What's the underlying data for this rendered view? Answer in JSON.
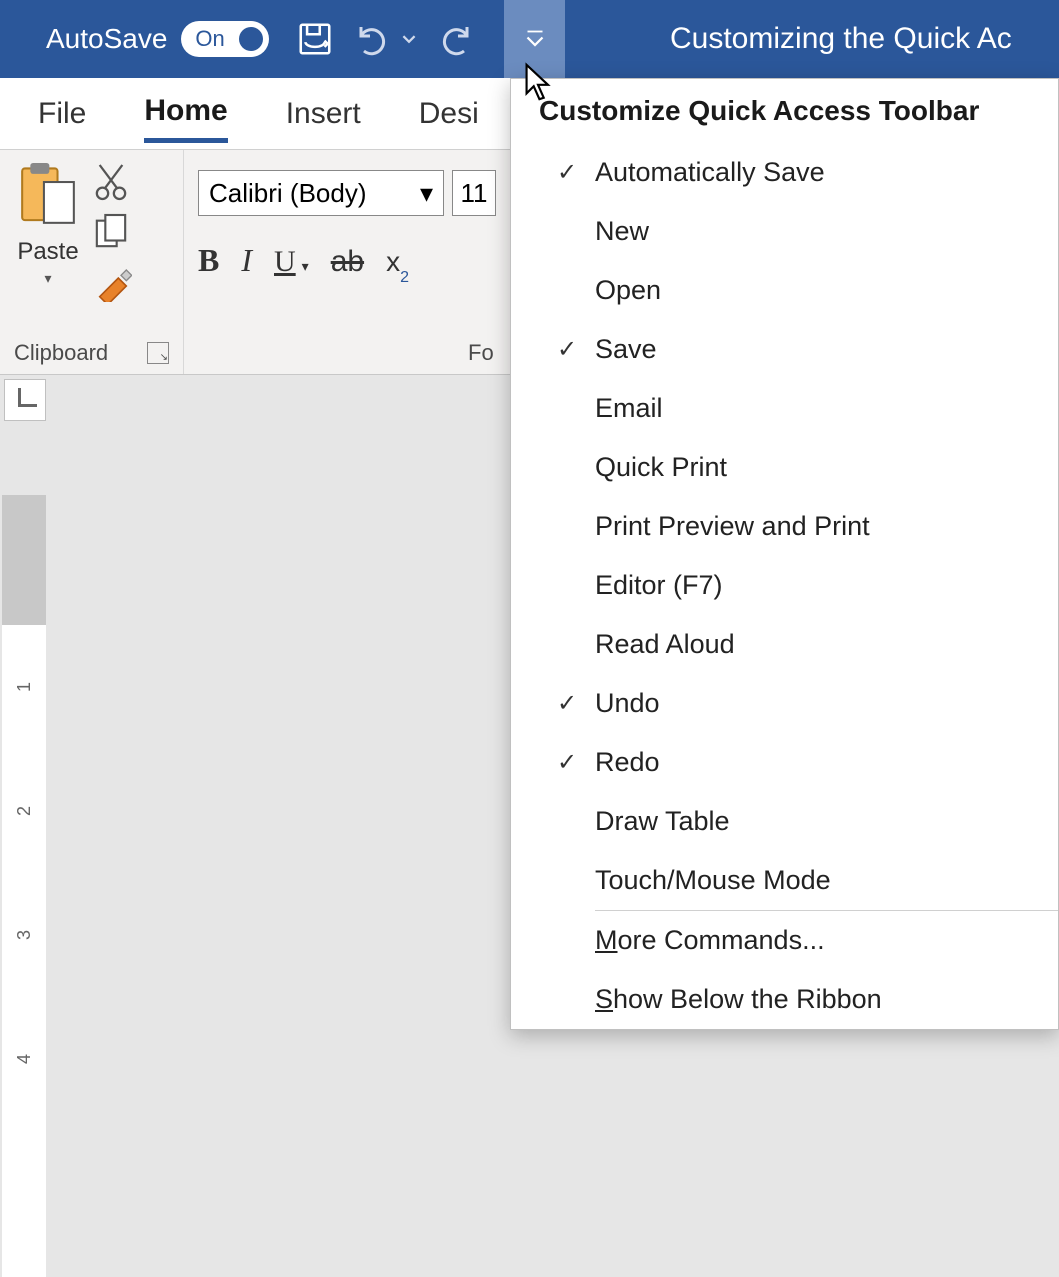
{
  "titlebar": {
    "autosave_label": "AutoSave",
    "autosave_on": "On",
    "document_title": "Customizing the Quick Ac"
  },
  "ribbon_tabs": {
    "file": "File",
    "home": "Home",
    "insert": "Insert",
    "design_partial": "Desi"
  },
  "clipboard_group": {
    "paste_label": "Paste",
    "group_name": "Clipboard"
  },
  "font_group": {
    "font_name": "Calibri (Body)",
    "font_size": "11",
    "group_name_partial": "Fo",
    "bold": "B",
    "italic": "I",
    "underline": "U",
    "strike": "ab",
    "subscript_x": "x",
    "subscript_2": "2"
  },
  "dropdown": {
    "title": "Customize Quick Access Toolbar",
    "items": [
      {
        "checked": true,
        "label": "Automatically Save"
      },
      {
        "checked": false,
        "label": "New"
      },
      {
        "checked": false,
        "label": "Open"
      },
      {
        "checked": true,
        "label": "Save"
      },
      {
        "checked": false,
        "label": "Email"
      },
      {
        "checked": false,
        "label": "Quick Print"
      },
      {
        "checked": false,
        "label": "Print Preview and Print"
      },
      {
        "checked": false,
        "label": "Editor (F7)"
      },
      {
        "checked": false,
        "label": "Read Aloud"
      },
      {
        "checked": true,
        "label": "Undo"
      },
      {
        "checked": true,
        "label": "Redo"
      },
      {
        "checked": false,
        "label": "Draw Table"
      },
      {
        "checked": false,
        "label": "Touch/Mouse Mode"
      }
    ],
    "more_commands": "More Commands...",
    "show_below": "Show Below the Ribbon"
  },
  "ruler": {
    "n1": "1",
    "n2": "2",
    "n3": "3",
    "n4": "4"
  }
}
